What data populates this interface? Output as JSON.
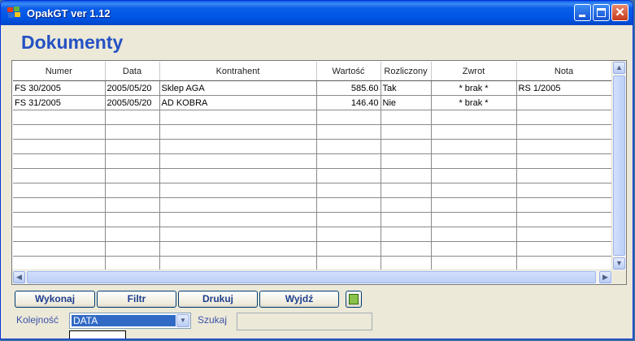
{
  "window": {
    "title": "OpakGT ver 1.12"
  },
  "page": {
    "heading": "Dokumenty"
  },
  "table": {
    "columns": [
      "Numer",
      "Data",
      "Kontrahent",
      "Wartość",
      "Rozliczony",
      "Zwrot",
      "Nota"
    ],
    "rows": [
      [
        "FS 30/2005",
        "2005/05/20",
        "Sklep AGA",
        "585.60",
        "Tak",
        "* brak *",
        "RS 1/2005"
      ],
      [
        "FS 31/2005",
        "2005/05/20",
        "AD KOBRA",
        "146.40",
        "Nie",
        "* brak *",
        ""
      ]
    ],
    "empty_rows": 11
  },
  "buttons": {
    "run": "Wykonaj",
    "filter": "Filtr",
    "print": "Drukuj",
    "exit": "Wyjdź"
  },
  "order": {
    "label": "Kolejność",
    "value": "DATA"
  },
  "search": {
    "label": "Szukaj",
    "value": ""
  },
  "icons": {
    "app": "windows-flag-icon",
    "minimize": "minimize-icon",
    "maximize": "maximize-icon",
    "close": "close-icon",
    "excel": "spreadsheet-export-icon"
  }
}
